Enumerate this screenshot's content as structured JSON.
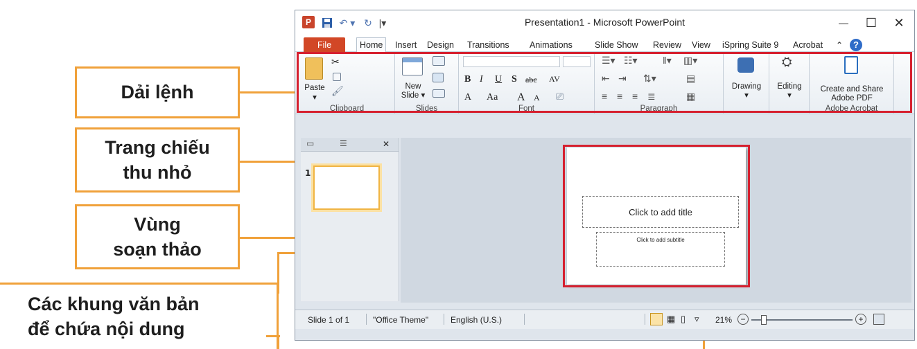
{
  "callouts": {
    "ribbon": "Dải lệnh",
    "thumbnails_line1": "Trang chiếu",
    "thumbnails_line2": "thu nhỏ",
    "edit_area_line1": "Vùng",
    "edit_area_line2": "soạn thảo",
    "text_frames_line1": "Các khung văn bản",
    "text_frames_line2": "để chứa nội dung"
  },
  "window": {
    "title": "Presentation1 - Microsoft PowerPoint",
    "app_icon_letter": "P",
    "minimize": "—",
    "maximize": "☐",
    "close": "✕"
  },
  "tabs": [
    "File",
    "Home",
    "Insert",
    "Design",
    "Transitions",
    "Animations",
    "Slide Show",
    "Review",
    "View",
    "iSpring Suite 9",
    "Acrobat"
  ],
  "ribbon": {
    "groups": {
      "clipboard": "Clipboard",
      "slides": "Slides",
      "font": "Font",
      "paragraph": "Paragraph",
      "adobe": "Adobe Acrobat"
    },
    "paste": "Paste",
    "new_slide_1": "New",
    "new_slide_2": "Slide ▾",
    "drawing": "Drawing",
    "editing": "Editing",
    "create_share_1": "Create and Share",
    "create_share_2": "Adobe PDF",
    "bold": "B",
    "italic": "I",
    "underline": "U",
    "strike": "S",
    "abc": "abc",
    "av": "AV",
    "font_color": "A",
    "case": "Aa",
    "grow": "A",
    "shrink": "A"
  },
  "left_pane": {
    "close": "✕",
    "slide_number": "1"
  },
  "slide": {
    "title_placeholder": "Click to add title",
    "subtitle_placeholder": "Click to add subtitle"
  },
  "status": {
    "slide_of": "Slide 1 of 1",
    "theme": "\"Office Theme\"",
    "language": "English (U.S.)",
    "zoom": "21%"
  },
  "colors": {
    "accent_orange": "#f0a13a",
    "highlight_red": "#d6202f",
    "file_tab": "#d24726"
  }
}
